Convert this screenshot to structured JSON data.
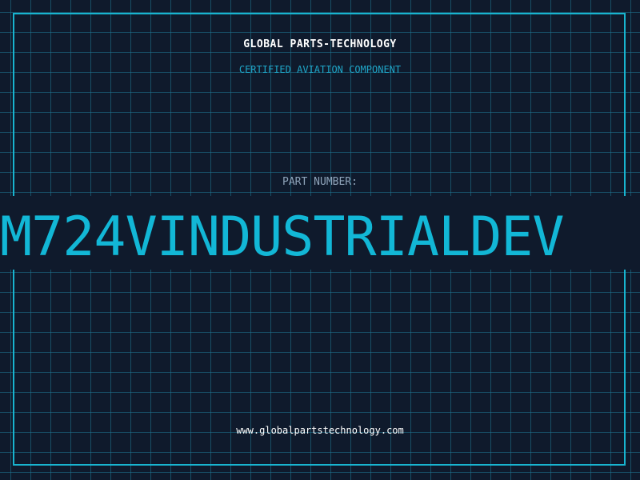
{
  "header": {
    "company": "GLOBAL PARTS-TECHNOLOGY",
    "certification": "CERTIFIED AVIATION COMPONENT"
  },
  "part": {
    "label": "PART NUMBER:",
    "number": "M724VINDUSTRIALDEV"
  },
  "footer": {
    "url": "www.globalpartstechnology.com"
  },
  "colors": {
    "background": "#0f1a2c",
    "accent": "#12b7d6",
    "grid": "#1e7896",
    "text": "#ffffff"
  }
}
